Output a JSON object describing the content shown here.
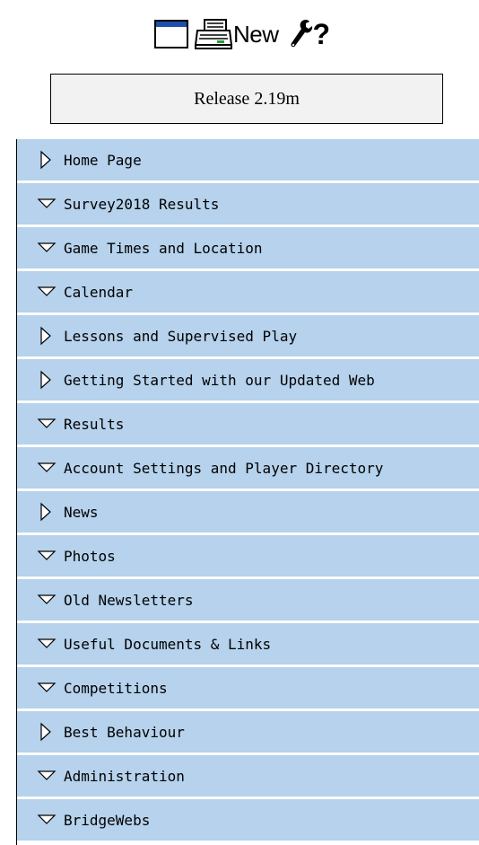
{
  "toolbar": {
    "icons": [
      "window-icon",
      "printer-icon",
      "wrench-icon"
    ],
    "new_label": "New",
    "help_label": "?"
  },
  "release": {
    "label": "Release 2.19m"
  },
  "colors": {
    "menu_background": "#b6d2ec",
    "window_bar": "#1f4fa8",
    "release_background": "#f2f2f2"
  },
  "menu": {
    "items": [
      {
        "label": "Home Page",
        "icon": "triangle-right-icon"
      },
      {
        "label": "Survey2018 Results",
        "icon": "triangle-down-icon"
      },
      {
        "label": "Game Times and Location",
        "icon": "triangle-down-icon"
      },
      {
        "label": "Calendar",
        "icon": "triangle-down-icon"
      },
      {
        "label": "Lessons and Supervised Play",
        "icon": "triangle-right-icon"
      },
      {
        "label": "Getting Started with our Updated Web",
        "icon": "triangle-right-icon"
      },
      {
        "label": "Results",
        "icon": "triangle-down-icon"
      },
      {
        "label": "Account Settings and Player Directory",
        "icon": "triangle-down-icon"
      },
      {
        "label": "News",
        "icon": "triangle-right-icon"
      },
      {
        "label": "Photos",
        "icon": "triangle-down-icon"
      },
      {
        "label": "Old Newsletters",
        "icon": "triangle-down-icon"
      },
      {
        "label": "Useful Documents & Links",
        "icon": "triangle-down-icon"
      },
      {
        "label": "Competitions",
        "icon": "triangle-down-icon"
      },
      {
        "label": "Best Behaviour",
        "icon": "triangle-right-icon"
      },
      {
        "label": "Administration",
        "icon": "triangle-down-icon"
      },
      {
        "label": "BridgeWebs",
        "icon": "triangle-down-icon"
      }
    ]
  }
}
